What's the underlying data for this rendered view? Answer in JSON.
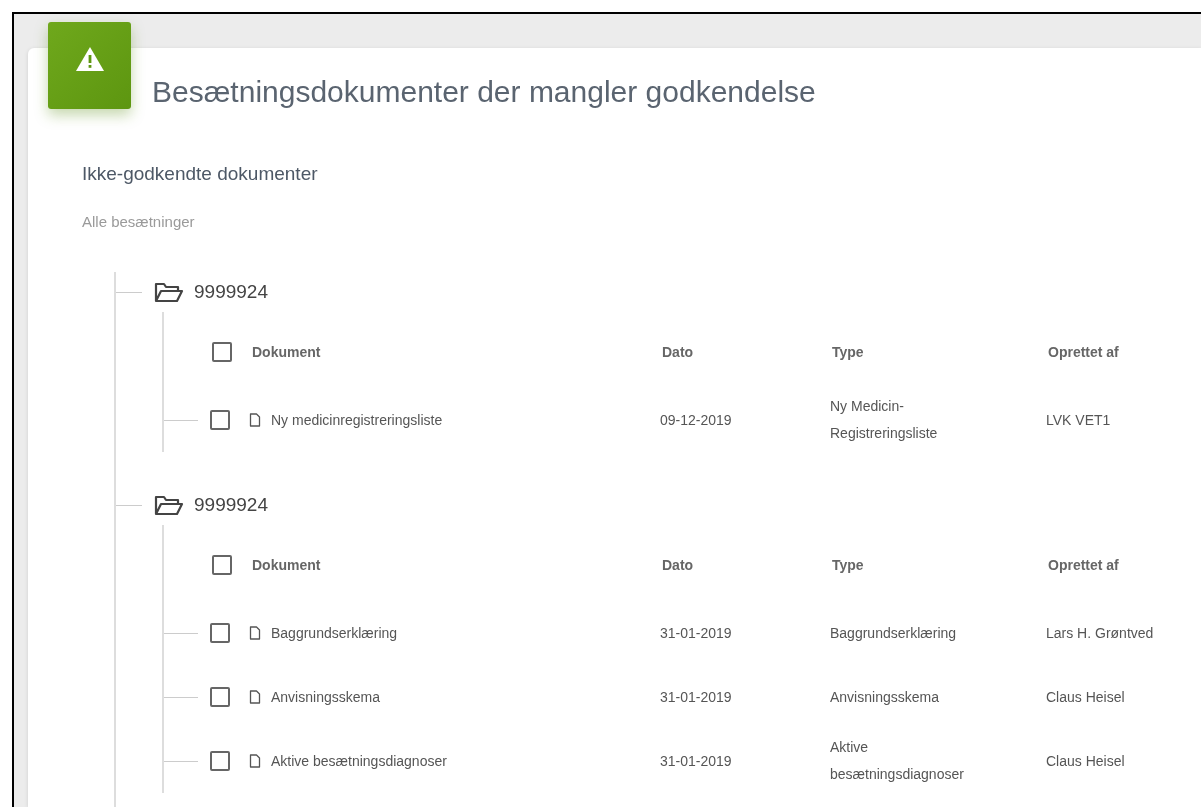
{
  "header": {
    "title": "Besætningsdokumenter der mangler godkendelse"
  },
  "section": {
    "title": "Ikke-godkendte dokumenter",
    "subtitle": "Alle besætninger"
  },
  "groups": [
    {
      "name": "9999924",
      "columns": [
        "Dokument",
        "Dato",
        "Type",
        "Oprettet af"
      ],
      "select_all_checked": false,
      "rows": [
        {
          "document": "Ny medicinregistreringsliste",
          "date": "09-12-2019",
          "type": "Ny Medicin-Registreringsliste",
          "created_by": "LVK VET1",
          "checked": false
        }
      ]
    },
    {
      "name": "9999924",
      "columns": [
        "Dokument",
        "Dato",
        "Type",
        "Oprettet af"
      ],
      "select_all_checked": false,
      "rows": [
        {
          "document": "Baggrundserklæring",
          "date": "31-01-2019",
          "type": "Baggrundserklæring",
          "created_by": "Lars H. Grøntved",
          "checked": false
        },
        {
          "document": "Anvisningsskema",
          "date": "31-01-2019",
          "type": "Anvisningsskema",
          "created_by": "Claus Heisel",
          "checked": false
        },
        {
          "document": "Aktive besætningsdiagnoser",
          "date": "31-01-2019",
          "type": "Aktive besætningsdiagnoser",
          "created_by": "Claus Heisel",
          "checked": false
        }
      ]
    }
  ]
}
